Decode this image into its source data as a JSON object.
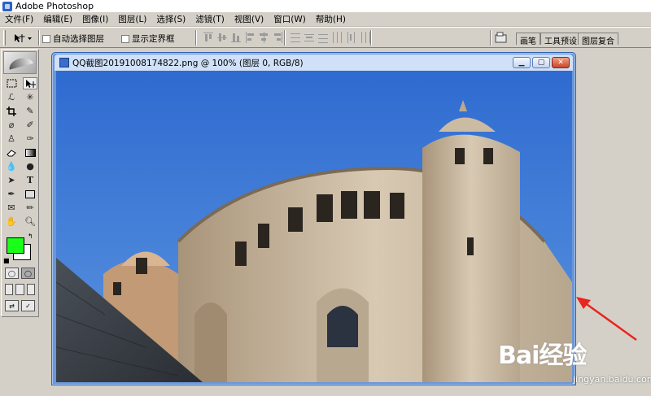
{
  "app": {
    "title": "Adobe Photoshop",
    "accent": "#2a62c8"
  },
  "menu": [
    "文件(F)",
    "编辑(E)",
    "图像(I)",
    "图层(L)",
    "选择(S)",
    "滤镜(T)",
    "视图(V)",
    "窗口(W)",
    "帮助(H)"
  ],
  "options": {
    "tool_preset_icon": "move-tool-icon",
    "auto_select_label": "自动选择图层",
    "auto_select_checked": false,
    "show_bounds_label": "显示定界框",
    "show_bounds_checked": false
  },
  "palette_well": {
    "tabs": [
      "画笔",
      "工具预设",
      "图层复合"
    ]
  },
  "toolbox": {
    "tools": [
      "marquee-icon",
      "move-icon",
      "lasso-icon",
      "magic-wand-icon",
      "crop-icon",
      "slice-icon",
      "healing-brush-icon",
      "brush-icon",
      "clone-stamp-icon",
      "history-brush-icon",
      "eraser-icon",
      "gradient-icon",
      "blur-icon",
      "dodge-icon",
      "path-select-icon",
      "type-icon",
      "pen-icon",
      "shape-icon",
      "notes-icon",
      "eyedropper-icon",
      "hand-icon",
      "zoom-icon"
    ],
    "foreground_color": "#1aff1a",
    "background_color": "#ffffff"
  },
  "document": {
    "title": "QQ截图20191008174822.png @ 100% (图层 0, RGB/8)",
    "controls": [
      "minimize-icon",
      "maximize-icon",
      "close-icon"
    ]
  },
  "watermark": {
    "brand": "Bai经验",
    "url": "jingyan.baidu.com"
  },
  "colors": {
    "sky": "#4a80d0",
    "stone": "#c9b8a0",
    "annotation": "#e8251e"
  }
}
